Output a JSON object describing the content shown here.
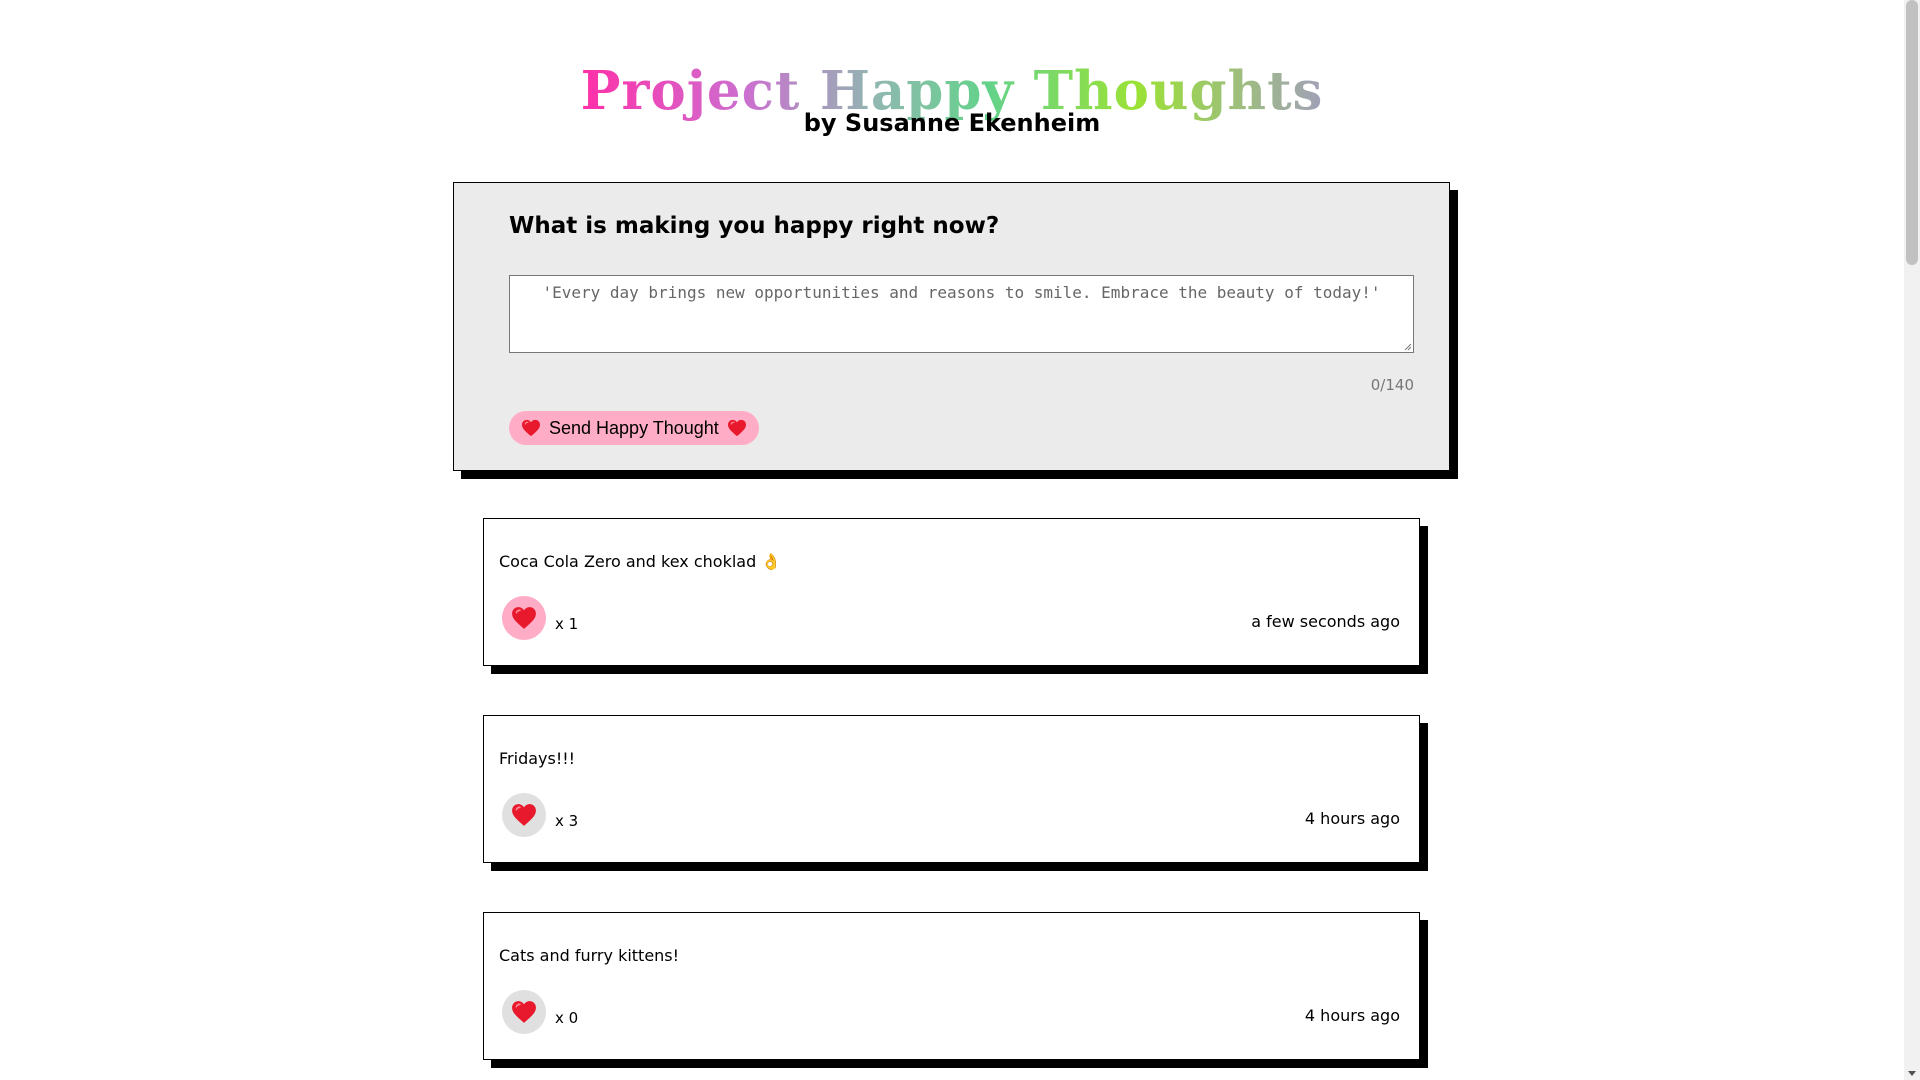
{
  "header": {
    "title": "Project Happy Thoughts",
    "subtitle": "by Susanne Ekenheim"
  },
  "form": {
    "question": "What is making you happy right now?",
    "placeholder": "'Every day brings new opportunities and reasons to smile. Embrace the beauty of today!'",
    "value": "",
    "char_count": "0/140",
    "send_label": "Send Happy Thought",
    "button_color": "#ffadc6"
  },
  "thoughts": [
    {
      "text": "Coca Cola Zero and kex choklad 👌",
      "likes": "x 1",
      "time": "a few seconds ago",
      "liked": true,
      "like_bg": "#ffadc6"
    },
    {
      "text": "Fridays!!!",
      "likes": "x 3",
      "time": "4 hours ago",
      "liked": false,
      "like_bg": "#e0e0e0"
    },
    {
      "text": "Cats and furry kittens!",
      "likes": "x 0",
      "time": "4 hours ago",
      "liked": false,
      "like_bg": "#e0e0e0"
    }
  ],
  "icons": {
    "heart": "heart-icon"
  }
}
